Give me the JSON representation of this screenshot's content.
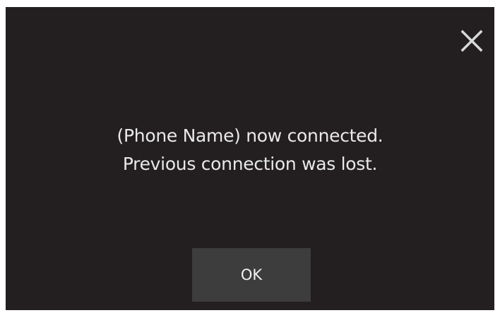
{
  "dialog": {
    "message_line1": "(Phone Name) now connected.",
    "message_line2": "Previous connection was lost.",
    "ok_label": "OK",
    "close_icon": "close-icon"
  },
  "colors": {
    "background": "#231f20",
    "button": "#3d3d3d",
    "text": "#e9e9e9"
  }
}
